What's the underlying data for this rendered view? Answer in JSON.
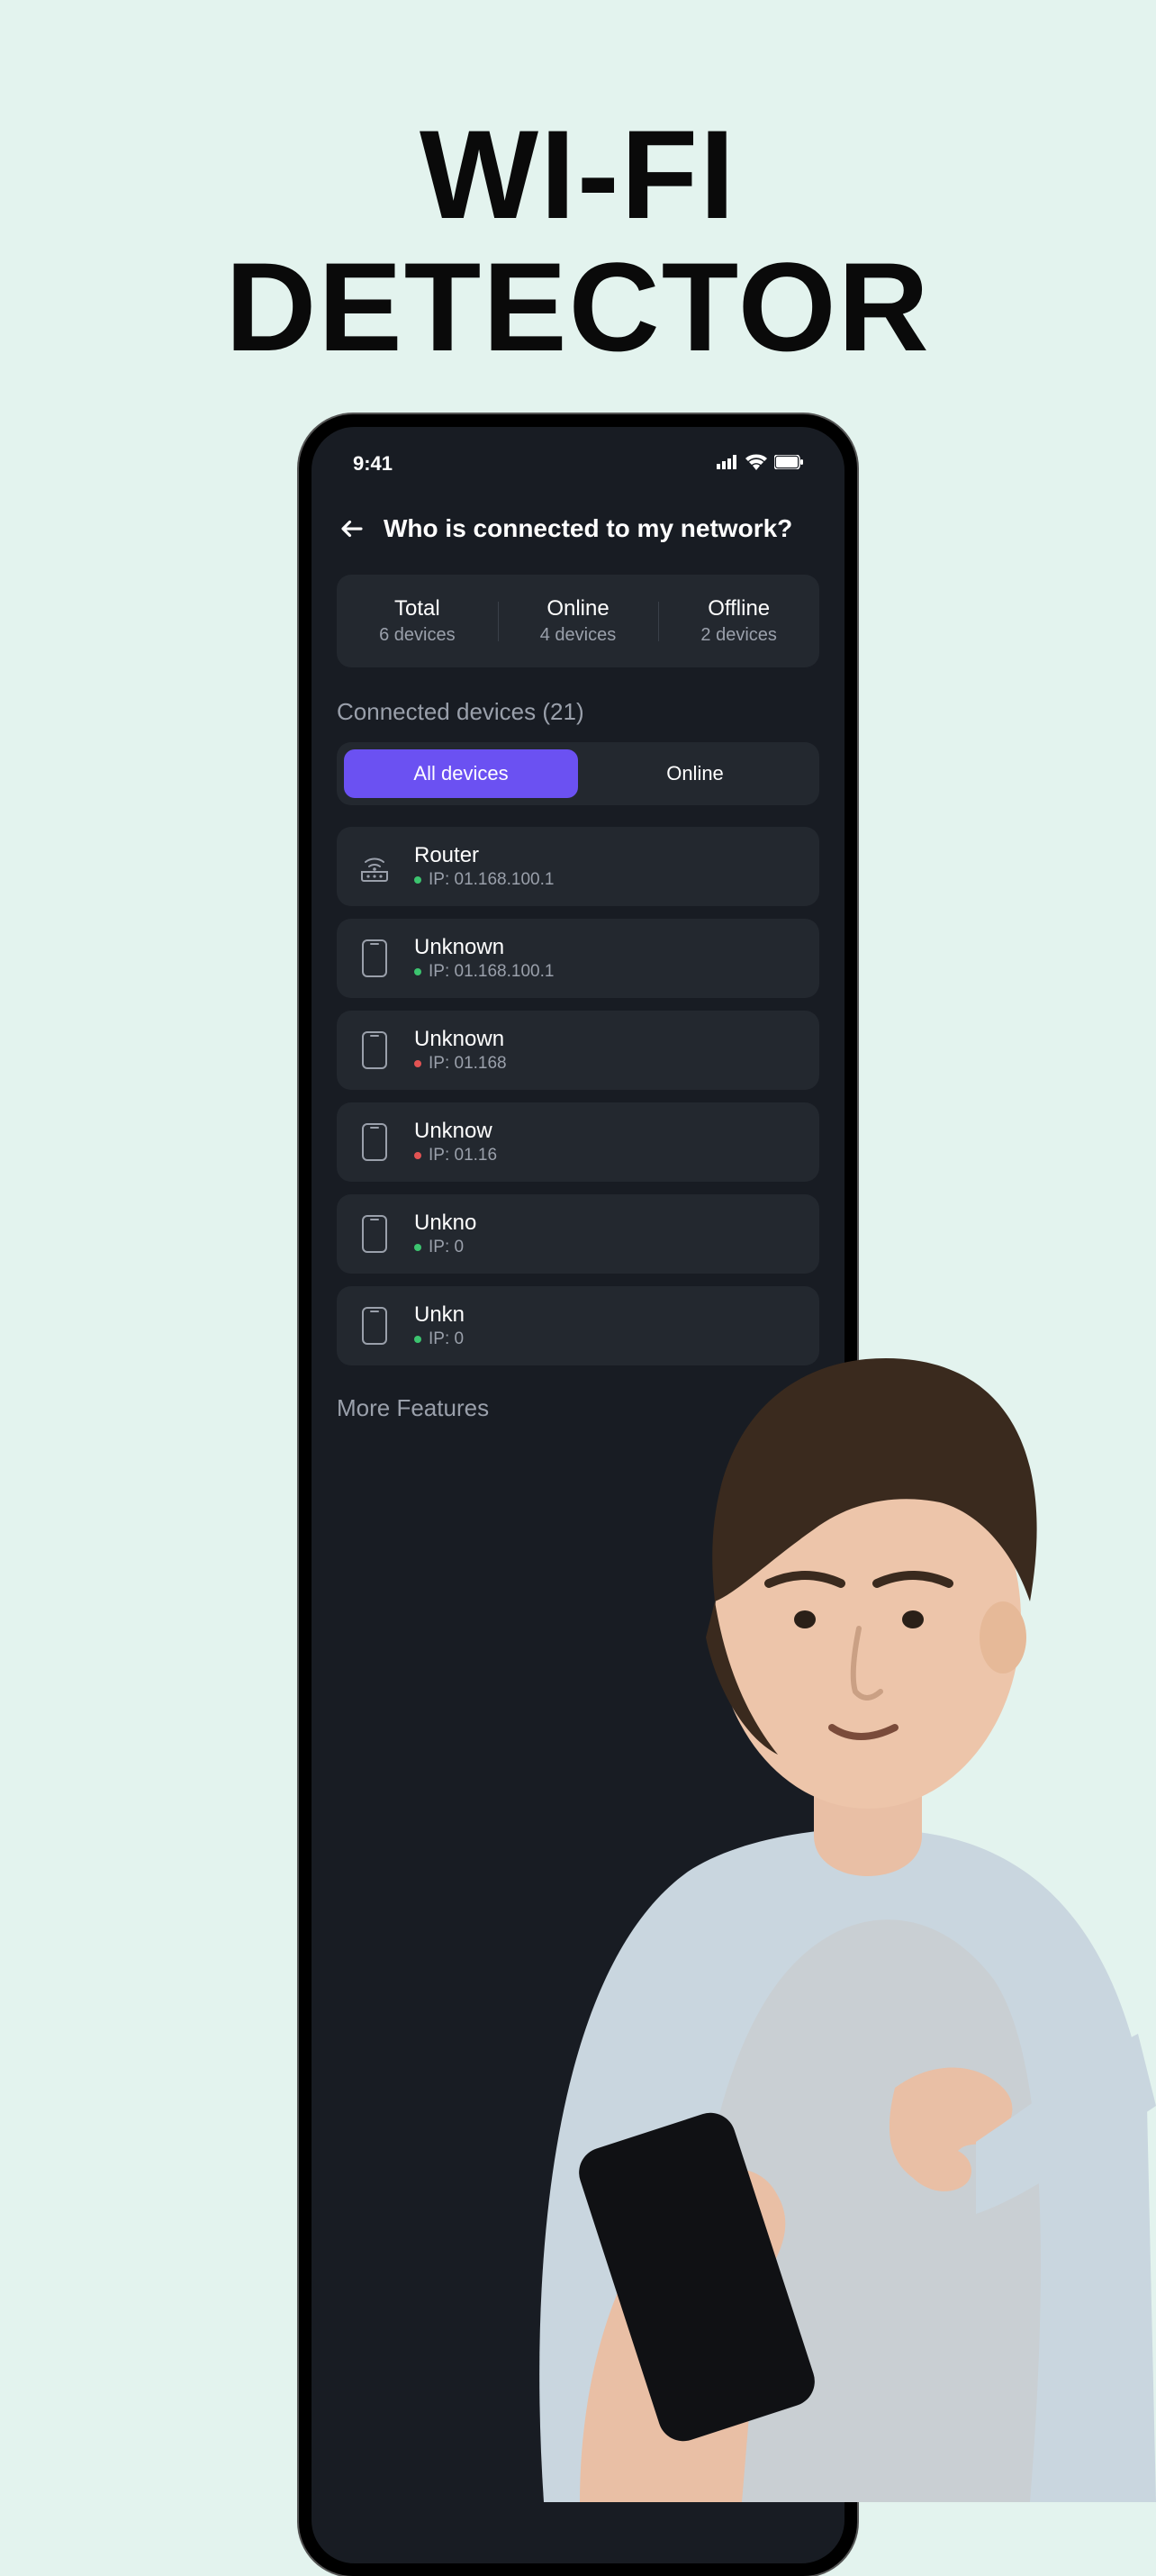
{
  "promo": {
    "line1": "WI-FI",
    "line2": "DETECTOR"
  },
  "status_bar": {
    "time": "9:41"
  },
  "header": {
    "title": "Who is connected to my network?"
  },
  "stats": {
    "total": {
      "title": "Total",
      "sub": "6 devices"
    },
    "online": {
      "title": "Online",
      "sub": "4 devices"
    },
    "offline": {
      "title": "Offline",
      "sub": "2 devices"
    }
  },
  "section": {
    "connected_label": "Connected devices (21)"
  },
  "tabs": {
    "all": "All devices",
    "online": "Online"
  },
  "devices": [
    {
      "name": "Router",
      "ip_label": "IP: 01.168.100.1",
      "status": "online",
      "icon": "router"
    },
    {
      "name": "Unknown",
      "ip_label": "IP: 01.168.100.1",
      "status": "online",
      "icon": "phone"
    },
    {
      "name": "Unknown",
      "ip_label": "IP: 01.168",
      "status": "offline",
      "icon": "phone"
    },
    {
      "name": "Unknow",
      "ip_label": "IP: 01.16",
      "status": "offline",
      "icon": "phone"
    },
    {
      "name": "Unkno",
      "ip_label": "IP: 0",
      "status": "online",
      "icon": "phone"
    },
    {
      "name": "Unkn",
      "ip_label": "IP: 0",
      "status": "online",
      "icon": "phone"
    }
  ],
  "more_features": "More Features"
}
